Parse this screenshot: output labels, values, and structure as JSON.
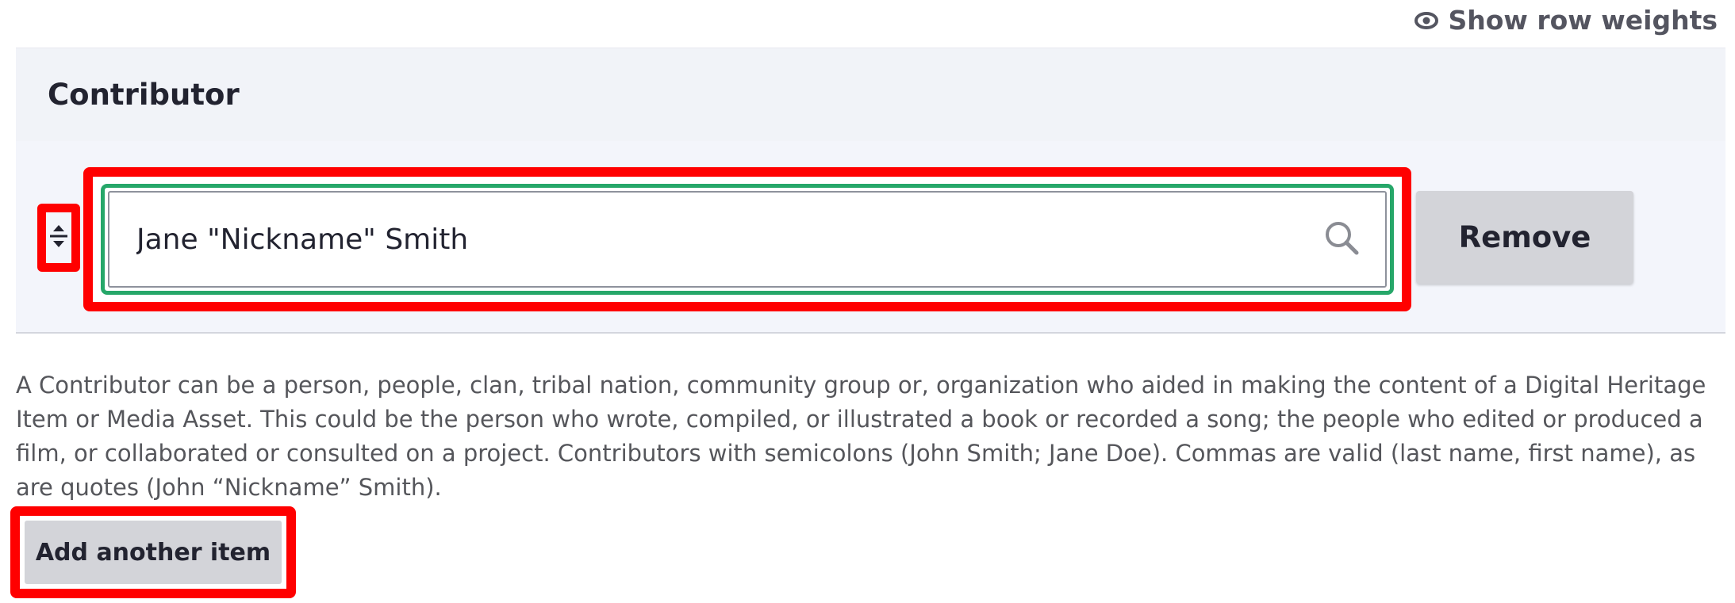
{
  "toolbar": {
    "show_row_weights_label": "Show row weights",
    "show_row_weights_icon": "eye-icon"
  },
  "field": {
    "title": "Contributor",
    "rows": [
      {
        "drag_handle_icon": "drag-handle-icon",
        "value": "Jane \"Nickname\" Smith",
        "search_icon": "search-icon",
        "remove_label": "Remove"
      }
    ],
    "description": "A Contributor can be a person, people, clan, tribal nation, community group or, organization who aided in making the content of a Digital Heritage Item or Media Asset. This could be the person who wrote, compiled, or illustrated a book or recorded a song; the people who edited or produced a film, or collaborated or consulted on a project. Contributors with semicolons (John Smith; Jane Doe). Commas are valid (last name, first name), as are quotes (John “Nickname” Smith).",
    "add_another_label": "Add another item"
  },
  "colors": {
    "highlight_red": "#ff0000",
    "focus_green": "#26a769",
    "button_gray": "#d3d4d9",
    "header_bg": "#f1f3f8"
  }
}
